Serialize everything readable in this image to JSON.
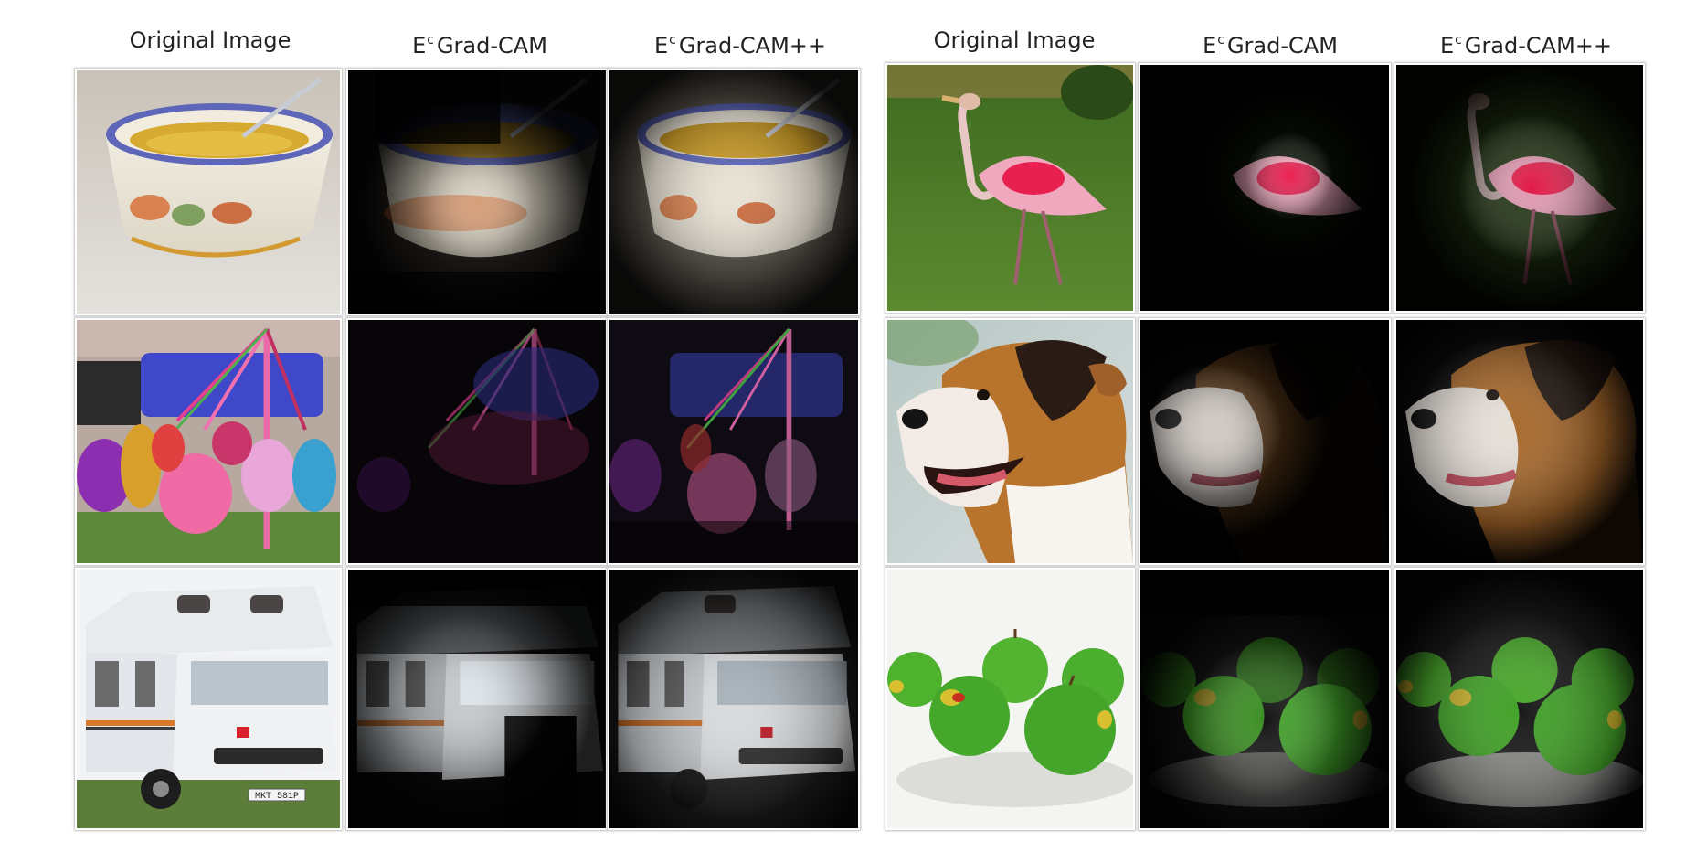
{
  "figure": {
    "left_group": {
      "headers": [
        {
          "main": "Original Image",
          "sup": ""
        },
        {
          "main": "Grad-CAM",
          "prefix": "E",
          "sup": "c"
        },
        {
          "main": "Grad-CAM++",
          "prefix": "E",
          "sup": "c"
        }
      ],
      "rows": [
        {
          "subject": "soup bowl"
        },
        {
          "subject": "maypole dancers"
        },
        {
          "subject": "camper van"
        }
      ]
    },
    "right_group": {
      "headers": [
        {
          "main": "Original Image",
          "sup": ""
        },
        {
          "main": "Grad-CAM",
          "prefix": "E",
          "sup": "c"
        },
        {
          "main": "Grad-CAM++",
          "prefix": "E",
          "sup": "c"
        }
      ],
      "rows": [
        {
          "subject": "spoonbill"
        },
        {
          "subject": "dog"
        },
        {
          "subject": "green apples"
        }
      ]
    },
    "van_plate_text": "MKT 581P",
    "colors": {
      "background": "#ffffff",
      "heatmap_dark": "#000000",
      "grass": "#4f7a24",
      "spoonbill_pink": "#e85078",
      "apple_green": "#4cae2e"
    }
  }
}
